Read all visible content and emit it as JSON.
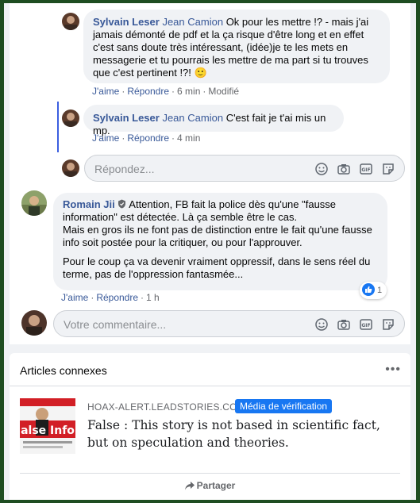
{
  "comments": [
    {
      "author": "Sylvain Leser",
      "mention": "Jean Camion",
      "text": "Ok pour les mettre !? - mais j'ai jamais démonté de pdf et la ça risque d'être long et en effet c'est sans doute très intéressant, (idée)je te les mets en messagerie et tu pourrais les mettre de ma part si tu trouves que c'est pertinent !?!",
      "emoji": "🙂",
      "like_label": "J'aime",
      "reply_label": "Répondre",
      "time": "6 min",
      "edited": "Modifié"
    },
    {
      "author": "Sylvain Leser",
      "mention": "Jean Camion",
      "text": "C'est fait je t'ai mis un mp.",
      "like_label": "J'aime",
      "reply_label": "Répondre",
      "time": "4 min"
    },
    {
      "author": "Romain Jii",
      "text_p1": "Attention, FB fait la police dès qu'une \"fausse information\" est détectée. Là ça semble être le cas.",
      "text_p2": "Mais en gros ils ne font pas de distinction entre le fait qu'une fausse info soit postée pour la critiquer, ou pour l'approuver.",
      "text_p3": "Pour le coup ça va devenir vraiment oppressif, dans le sens réel du terme, pas de l'oppression fantasmée...",
      "like_label": "J'aime",
      "reply_label": "Répondre",
      "time": "1 h",
      "reaction_count": "1"
    }
  ],
  "reply_input": {
    "placeholder": "Répondez..."
  },
  "comment_input": {
    "placeholder": "Votre commentaire..."
  },
  "articles": {
    "heading": "Articles connexes",
    "domain": "HOAX-ALERT.LEADSTORIES.COM",
    "badge": "Média de vérification",
    "title": "False : This story is not based in scientific fact, but on speculation and theories.",
    "thumb_text": "alse Info",
    "share_label": "Partager"
  },
  "colors": {
    "link": "#385898",
    "accent": "#1877f2",
    "frame": "#1e4d21"
  }
}
